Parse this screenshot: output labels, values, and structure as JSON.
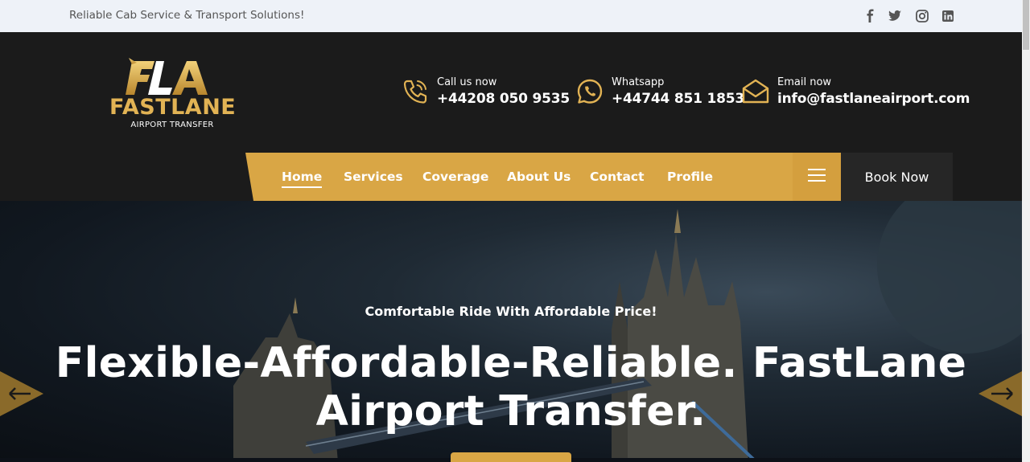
{
  "topbar": {
    "tagline": "Reliable Cab Service & Transport Solutions!",
    "social": [
      "facebook-icon",
      "twitter-icon",
      "instagram-icon",
      "linkedin-icon"
    ]
  },
  "logo": {
    "mark": "FLA",
    "name": "FASTLANE",
    "sub": "AIRPORT TRANSFER"
  },
  "contacts": [
    {
      "label": "Call us now",
      "value": "+44208 050 9535",
      "icon": "phone-icon"
    },
    {
      "label": "Whatsapp",
      "value": "+44744 851 1853",
      "icon": "whatsapp-icon"
    },
    {
      "label": "Email now",
      "value": "info@fastlaneairport.com",
      "icon": "envelope-icon"
    }
  ],
  "nav": {
    "items": [
      "Home",
      "Services",
      "Coverage",
      "About Us",
      "Contact",
      "Profile"
    ],
    "active": "Home",
    "book_label": "Book Now"
  },
  "hero": {
    "subtitle": "Comfortable Ride With Affordable Price!",
    "title_line1": "Flexible-Affordable-Reliable. FastLane",
    "title_line2": "Airport Transfer."
  },
  "colors": {
    "accent": "#d9a645",
    "header_bg": "#1b1b1b",
    "topbar_bg": "#eef2f8"
  }
}
